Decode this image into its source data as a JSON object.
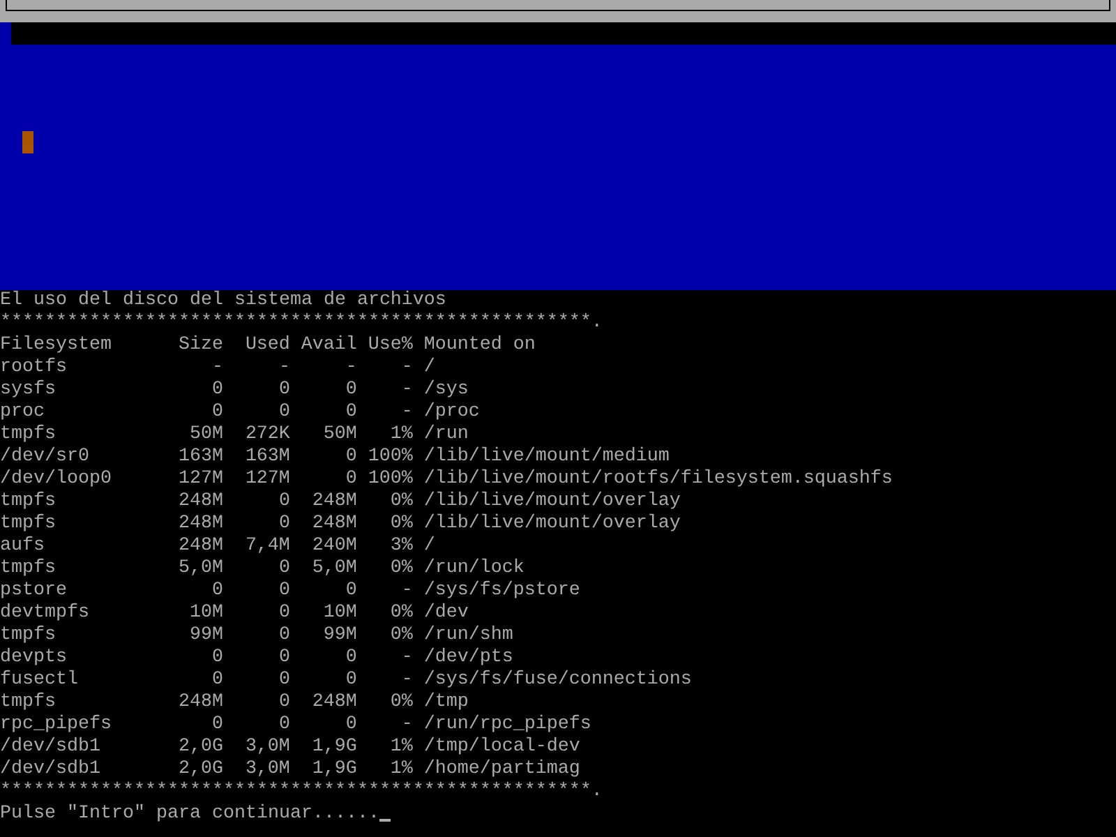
{
  "title": "El uso del disco del sistema de archivos",
  "separator_top": "*****************************************************.",
  "columns": [
    "Filesystem",
    "Size",
    "Used",
    "Avail",
    "Use%",
    "Mounted on"
  ],
  "rows": [
    [
      "rootfs",
      "-",
      "-",
      "-",
      "-",
      "/"
    ],
    [
      "sysfs",
      "0",
      "0",
      "0",
      "-",
      "/sys"
    ],
    [
      "proc",
      "0",
      "0",
      "0",
      "-",
      "/proc"
    ],
    [
      "tmpfs",
      "50M",
      "272K",
      "50M",
      "1%",
      "/run"
    ],
    [
      "/dev/sr0",
      "163M",
      "163M",
      "0",
      "100%",
      "/lib/live/mount/medium"
    ],
    [
      "/dev/loop0",
      "127M",
      "127M",
      "0",
      "100%",
      "/lib/live/mount/rootfs/filesystem.squashfs"
    ],
    [
      "tmpfs",
      "248M",
      "0",
      "248M",
      "0%",
      "/lib/live/mount/overlay"
    ],
    [
      "tmpfs",
      "248M",
      "0",
      "248M",
      "0%",
      "/lib/live/mount/overlay"
    ],
    [
      "aufs",
      "248M",
      "7,4M",
      "240M",
      "3%",
      "/"
    ],
    [
      "tmpfs",
      "5,0M",
      "0",
      "5,0M",
      "0%",
      "/run/lock"
    ],
    [
      "pstore",
      "0",
      "0",
      "0",
      "-",
      "/sys/fs/pstore"
    ],
    [
      "devtmpfs",
      "10M",
      "0",
      "10M",
      "0%",
      "/dev"
    ],
    [
      "tmpfs",
      "99M",
      "0",
      "99M",
      "0%",
      "/run/shm"
    ],
    [
      "devpts",
      "0",
      "0",
      "0",
      "-",
      "/dev/pts"
    ],
    [
      "fusectl",
      "0",
      "0",
      "0",
      "-",
      "/sys/fs/fuse/connections"
    ],
    [
      "tmpfs",
      "248M",
      "0",
      "248M",
      "0%",
      "/tmp"
    ],
    [
      "rpc_pipefs",
      "0",
      "0",
      "0",
      "-",
      "/run/rpc_pipefs"
    ],
    [
      "/dev/sdb1",
      "2,0G",
      "3,0M",
      "1,9G",
      "1%",
      "/tmp/local-dev"
    ],
    [
      "/dev/sdb1",
      "2,0G",
      "3,0M",
      "1,9G",
      "1%",
      "/home/partimag"
    ]
  ],
  "separator_bottom": "*****************************************************.",
  "prompt": "Pulse \"Intro\" para continuar......"
}
